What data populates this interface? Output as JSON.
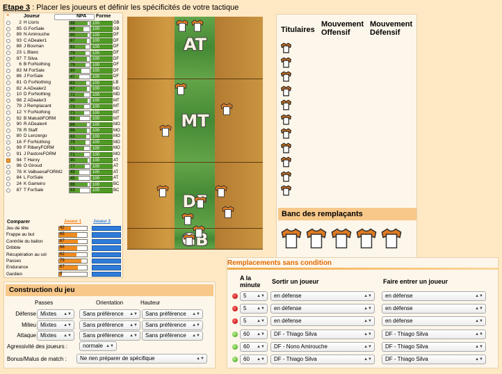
{
  "step": {
    "label": "Etape 3",
    "text": " : Placer les joueurs et définir les spécificités de votre tactique"
  },
  "roster": {
    "headers": {
      "joueur": "Joueur",
      "npa": "NPA",
      "forme": "Forme"
    },
    "players": [
      {
        "num": "2",
        "name": "H Lloris",
        "npa": 88,
        "forme": "100",
        "pos": "GB"
      },
      {
        "num": "95",
        "name": "G ForSale",
        "npa": 69,
        "forme": "100",
        "pos": "GB"
      },
      {
        "num": "89",
        "name": "N Amirouche",
        "npa": 90,
        "forme": "100",
        "pos": "DF"
      },
      {
        "num": "93",
        "name": "C ADealer1",
        "npa": 87,
        "forme": "100",
        "pos": "DF"
      },
      {
        "num": "88",
        "name": "J Bosman",
        "npa": 81,
        "forme": "100",
        "pos": "DF"
      },
      {
        "num": "23",
        "name": "L Blanc",
        "npa": 79,
        "forme": "100",
        "pos": "DF"
      },
      {
        "num": "97",
        "name": "T Silva",
        "npa": 87,
        "forme": "100",
        "pos": "DF"
      },
      {
        "num": "6",
        "name": "B ForNothing",
        "npa": 79,
        "forme": "100",
        "pos": "DF"
      },
      {
        "num": "83",
        "name": "M ForSale",
        "npa": 60,
        "forme": "100",
        "pos": "DF"
      },
      {
        "num": "86",
        "name": "J ForSale",
        "npa": 47,
        "forme": "100",
        "pos": "DF"
      },
      {
        "num": "81",
        "name": "G ForNothing",
        "npa": 83,
        "forme": "100",
        "pos": "LB"
      },
      {
        "num": "82",
        "name": "A ADealer2",
        "npa": 87,
        "forme": "100",
        "pos": "MD"
      },
      {
        "num": "10",
        "name": "D ForNothing",
        "npa": 72,
        "forme": "100",
        "pos": "MD"
      },
      {
        "num": "98",
        "name": "Z ADealer3",
        "npa": 90,
        "forme": "100",
        "pos": "MT"
      },
      {
        "num": "79",
        "name": "J Remplacant",
        "npa": 73,
        "forme": "100",
        "pos": "MT"
      },
      {
        "num": "12",
        "name": "Y ForNothing",
        "npa": 71,
        "forme": "100",
        "pos": "MT"
      },
      {
        "num": "92",
        "name": "B MatuidiFORM",
        "npa": 53,
        "forme": "100",
        "pos": "MT"
      },
      {
        "num": "90",
        "name": "R ADealer4",
        "npa": 86,
        "forme": "100",
        "pos": "MO"
      },
      {
        "num": "78",
        "name": "R Staff",
        "npa": 86,
        "forme": "100",
        "pos": "MO"
      },
      {
        "num": "80",
        "name": "D Lenzergo",
        "npa": 83,
        "forme": "100",
        "pos": "MO"
      },
      {
        "num": "16",
        "name": "F ForNothing",
        "npa": 79,
        "forme": "100",
        "pos": "MO"
      },
      {
        "num": "99",
        "name": "F RiberyFORM",
        "npa": 71,
        "forme": "100",
        "pos": "MO"
      },
      {
        "num": "91",
        "name": "J PastoreFORM",
        "npa": 71,
        "forme": "100",
        "pos": "MO"
      },
      {
        "num": "94",
        "name": "T Henry",
        "npa": 90,
        "forme": "100",
        "pos": "AT"
      },
      {
        "num": "96",
        "name": "O Giroud",
        "npa": 77,
        "forme": "100",
        "pos": "AT"
      },
      {
        "num": "78",
        "name": "K ValbuenaFORM2",
        "npa": 49,
        "forme": "100",
        "pos": "AT"
      },
      {
        "num": "84",
        "name": "L ForSale",
        "npa": 45,
        "forme": "100",
        "pos": "AT"
      },
      {
        "num": "24",
        "name": "K Gameiro",
        "npa": 88,
        "forme": "100",
        "pos": "BC"
      },
      {
        "num": "87",
        "name": "T ForSale",
        "npa": 53,
        "forme": "100",
        "pos": "BC"
      }
    ]
  },
  "compare": {
    "label": "Comparer",
    "j1": "Joueur 1",
    "j2": "Joueur 2",
    "stats": [
      {
        "label": "Jeu de tête",
        "value": 42
      },
      {
        "label": "Frappe au but",
        "value": 65
      },
      {
        "label": "Contrôle du ballon",
        "value": 67
      },
      {
        "label": "Dribble",
        "value": 66
      },
      {
        "label": "Récupération au sol",
        "value": 62
      },
      {
        "label": "Passes",
        "value": 79
      },
      {
        "label": "Endurance",
        "value": 67
      },
      {
        "label": "Gardien",
        "value": 9
      }
    ]
  },
  "field": {
    "zones": {
      "at": "AT",
      "mt": "MT",
      "df": "DF",
      "gb": "GB"
    }
  },
  "squad": {
    "titulaires": "Titulaires",
    "mouv_off": "Mouvement\nOffensif",
    "mouv_def": "Mouvement\nDéfensif",
    "bench": "Banc des remplaçants"
  },
  "subs": {
    "title": "Remplacements sans condition",
    "h_minute": "A la\nminute",
    "h_out": "Sortir un joueur",
    "h_in": "Faire entrer un joueur",
    "rows": [
      {
        "status": "red",
        "minute": "5",
        "out": "en défense",
        "in": "en défense"
      },
      {
        "status": "red",
        "minute": "5",
        "out": "en défense",
        "in": "en défense"
      },
      {
        "status": "red",
        "minute": "5",
        "out": "en défense",
        "in": "en défense"
      },
      {
        "status": "green",
        "minute": "60",
        "out": "DF - Thiago Silva",
        "in": "DF - Thiago Silva"
      },
      {
        "status": "green",
        "minute": "60",
        "out": "DF - Nono Amirouche",
        "in": "DF - Thiago Silva"
      },
      {
        "status": "green",
        "minute": "60",
        "out": "DF - Thiago Silva",
        "in": "DF - Thiago Silva"
      }
    ]
  },
  "construction": {
    "title": "Construction du jeu",
    "h_passes": "Passes",
    "h_orient": "Orientation",
    "h_hauteur": "Hauteur",
    "rows": [
      {
        "label": "Défense",
        "passes": "Mixtes",
        "orient": "Sans préférence",
        "hauteur": "Sans préférence"
      },
      {
        "label": "Milieu",
        "passes": "Mixtes",
        "orient": "Sans préférence",
        "hauteur": "Sans préférence"
      },
      {
        "label": "Attaque",
        "passes": "Mixtes",
        "orient": "Sans préférence",
        "hauteur": "Sans préférence"
      }
    ],
    "aggr_label": "Agressivité des joueurs :",
    "aggr_value": "normale",
    "bonus_label": "Bonus/Malus de match :",
    "bonus_value": "Ne rien préparer de spécifique"
  }
}
